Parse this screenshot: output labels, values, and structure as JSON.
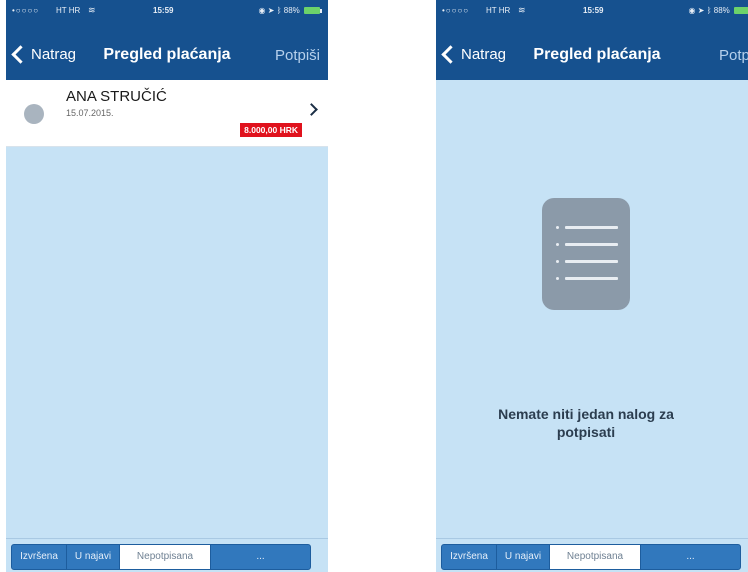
{
  "status_bar": {
    "signal": "•○○○○",
    "carrier": "HT HR",
    "time": "15:59",
    "battery": "88%",
    "icons": [
      "wifi-icon",
      "lock-rotation-icon",
      "location-icon",
      "bluetooth-icon",
      "battery-icon"
    ]
  },
  "screens": [
    {
      "nav": {
        "back_label": "Natrag",
        "title": "Pregled plaćanja",
        "action_label": "Potpiši"
      },
      "list": [
        {
          "name": "ANA STRUČIĆ",
          "date": "15.07.2015.",
          "amount": "8.000,00 HRK"
        }
      ],
      "tabs": [
        "Izvršena",
        "U najavi",
        "Nepotpisana",
        "..."
      ],
      "active_tab": "Nepotpisana"
    },
    {
      "nav": {
        "back_label": "Natrag",
        "title": "Pregled plaćanja",
        "action_label": "Potpiši"
      },
      "empty_state": {
        "icon": "list-document-icon",
        "message": "Nemate niti jedan nalog za potpisati"
      },
      "tabs": [
        "Izvršena",
        "U najavi",
        "Nepotpisana",
        "..."
      ],
      "active_tab": "Nepotpisana"
    }
  ],
  "colors": {
    "nav_bar": "#16518f",
    "content_background": "#c6e2f5",
    "amount_badge": "#e0121d",
    "tab_active": "#ffffff",
    "tab_inactive": "#3178bd"
  }
}
